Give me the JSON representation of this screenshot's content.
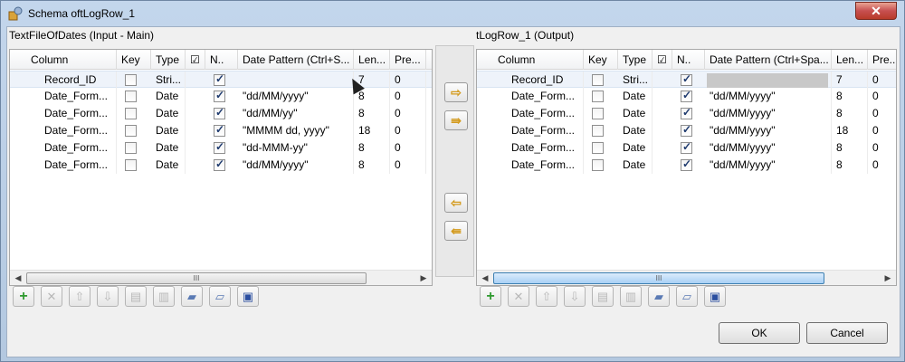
{
  "window": {
    "title": "Schema oftLogRow_1",
    "close_label": "✕"
  },
  "input_panel": {
    "title": "TextFileOfDates (Input - Main)",
    "headers": [
      "Column",
      "Key",
      "Type",
      "☑",
      "N..",
      "Date Pattern (Ctrl+S...",
      "Len...",
      "Pre..."
    ],
    "rows": [
      {
        "column": "Record_ID",
        "key": false,
        "type": "Stri...",
        "nullable": true,
        "pattern": "",
        "length": "7",
        "precision": "0"
      },
      {
        "column": "Date_Form...",
        "key": false,
        "type": "Date",
        "nullable": true,
        "pattern": "\"dd/MM/yyyy\"",
        "length": "8",
        "precision": "0"
      },
      {
        "column": "Date_Form...",
        "key": false,
        "type": "Date",
        "nullable": true,
        "pattern": "\"dd/MM/yy\"",
        "length": "8",
        "precision": "0"
      },
      {
        "column": "Date_Form...",
        "key": false,
        "type": "Date",
        "nullable": true,
        "pattern": "\"MMMM dd, yyyy\"",
        "length": "18",
        "precision": "0"
      },
      {
        "column": "Date_Form...",
        "key": false,
        "type": "Date",
        "nullable": true,
        "pattern": "\"dd-MMM-yy\"",
        "length": "8",
        "precision": "0"
      },
      {
        "column": "Date_Form...",
        "key": false,
        "type": "Date",
        "nullable": true,
        "pattern": "\"dd/MM/yyyy\"",
        "length": "8",
        "precision": "0"
      }
    ],
    "scroll_thumb": "III"
  },
  "output_panel": {
    "title": "tLogRow_1 (Output)",
    "headers": [
      "Column",
      "Key",
      "Type",
      "☑",
      "N..",
      "Date Pattern (Ctrl+Spa...",
      "Len...",
      "Pre..."
    ],
    "rows": [
      {
        "column": "Record_ID",
        "key": false,
        "type": "Stri...",
        "nullable": true,
        "pattern": "",
        "length": "7",
        "precision": "0"
      },
      {
        "column": "Date_Form...",
        "key": false,
        "type": "Date",
        "nullable": true,
        "pattern": "\"dd/MM/yyyy\"",
        "length": "8",
        "precision": "0"
      },
      {
        "column": "Date_Form...",
        "key": false,
        "type": "Date",
        "nullable": true,
        "pattern": "\"dd/MM/yyyy\"",
        "length": "8",
        "precision": "0"
      },
      {
        "column": "Date_Form...",
        "key": false,
        "type": "Date",
        "nullable": true,
        "pattern": "\"dd/MM/yyyy\"",
        "length": "18",
        "precision": "0"
      },
      {
        "column": "Date_Form...",
        "key": false,
        "type": "Date",
        "nullable": true,
        "pattern": "\"dd/MM/yyyy\"",
        "length": "8",
        "precision": "0"
      },
      {
        "column": "Date_Form...",
        "key": false,
        "type": "Date",
        "nullable": true,
        "pattern": "\"dd/MM/yyyy\"",
        "length": "8",
        "precision": "0"
      }
    ],
    "scroll_thumb": "III"
  },
  "transfer_buttons": {
    "copy_selected_right": "⇨",
    "copy_all_right": "⇛",
    "copy_selected_left": "⇦",
    "copy_all_left": "⇚"
  },
  "toolbar_icons": {
    "add": "+",
    "remove": "✕",
    "move_up": "⇧",
    "move_down": "⇩",
    "copy": "▤",
    "paste": "▥",
    "import": "▰",
    "export": "▱",
    "save": "▣"
  },
  "buttons": {
    "ok": "OK",
    "cancel": "Cancel"
  },
  "colors": {
    "accent": "#3c7fb1",
    "title_bar": "#c3d6ec",
    "close": "#c75050"
  }
}
